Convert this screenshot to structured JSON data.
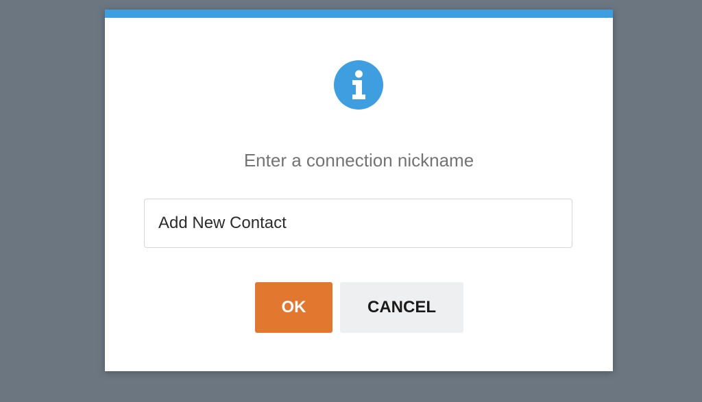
{
  "dialog": {
    "icon": "info-icon",
    "message": "Enter a connection nickname",
    "input_value": "Add New Contact",
    "ok_label": "OK",
    "cancel_label": "CANCEL"
  },
  "colors": {
    "backdrop": "#6b7681",
    "accent_bar": "#3f9ee0",
    "info_icon": "#3f9ee0",
    "ok_button": "#e27730",
    "cancel_button": "#edeff1"
  }
}
